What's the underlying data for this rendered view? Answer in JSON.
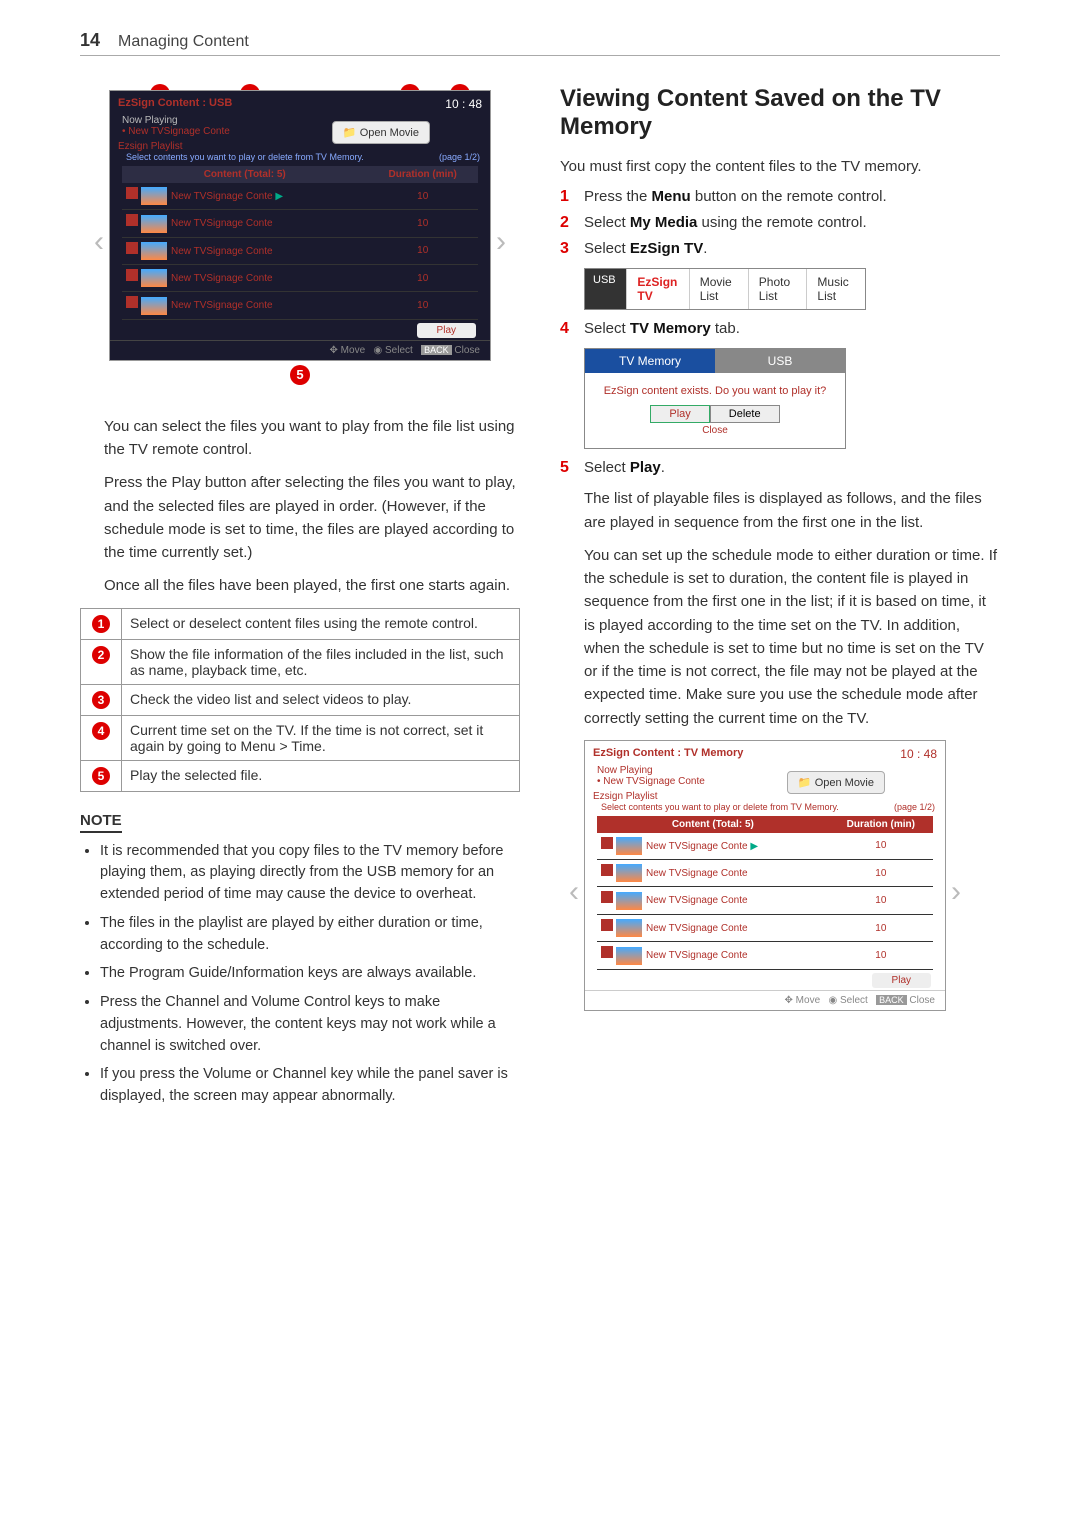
{
  "page_number": "14",
  "section_title": "Managing Content",
  "right": {
    "heading": "Viewing Content Saved on the TV Memory",
    "intro": "You must first copy the content files to the TV memory.",
    "step1": "Press the Menu button on the remote control.",
    "step1_bold": "Menu",
    "step2": "Select My Media using the remote control.",
    "step2_bold": "My Media",
    "step3": "Select EzSign TV.",
    "step3_bold": "EzSign TV",
    "step4": "Select TV Memory tab.",
    "step4_bold": "TV Memory",
    "step5": "Select Play.",
    "step5_bold": "Play",
    "after5_p1": "The list of playable files is displayed as follows, and the files are played in sequence from the first one in the list.",
    "after5_p2": "You can set up the schedule mode to either duration or time. If the schedule is set to duration, the content file is played in sequence from the first one in the list; if it is based on time, it is played according to the time set on the TV. In addition, when the schedule is set to time but no time is set on the TV or if the time is not correct, the file may not be played at the expected time. Make sure you use the schedule mode after correctly setting the current time on the TV."
  },
  "tabs": {
    "usb_label": "USB",
    "ezsigntv": "EzSign TV",
    "movielist": "Movie List",
    "photolist": "Photo List",
    "musiclist": "Music List"
  },
  "memory_dialog": {
    "tvmem": "TV Memory",
    "usb": "USB",
    "question": "EzSign content exists. Do you want to play it?",
    "play": "Play",
    "delete": "Delete",
    "close": "Close"
  },
  "ui_usb": {
    "title": "EzSign Content : USB",
    "time": "10 : 48",
    "now_playing": "Now Playing",
    "now_item": "• New TVSignage Conte",
    "open": "Open Movie",
    "playlist_label": "Ezsign Playlist",
    "hint": "Select contents you want to play or delete from TV Memory.",
    "pager": "(page 1/2)",
    "col1": "Content (Total: 5)",
    "col2": "Duration (min)",
    "rows": [
      {
        "name": "New TVSignage Conte",
        "dur": "10",
        "playing": true
      },
      {
        "name": "New TVSignage Conte",
        "dur": "10"
      },
      {
        "name": "New TVSignage Conte",
        "dur": "10"
      },
      {
        "name": "New TVSignage Conte",
        "dur": "10"
      },
      {
        "name": "New TVSignage Conte",
        "dur": "10"
      }
    ],
    "playbtn": "Play",
    "footer_move": "Move",
    "footer_select": "Select",
    "footer_close": "Close",
    "footer_back": "BACK"
  },
  "ui_tvmem": {
    "title": "EzSign Content : TV Memory"
  },
  "left": {
    "p1": "You can select the files you want to play from the file list using the TV remote control.",
    "p2": "Press the Play button after selecting the files you want to play, and the selected files are played in order. (However, if the schedule mode is set to time, the files are played according to the time currently set.)",
    "p3": "Once all the files have been played, the first one starts again.",
    "legend": {
      "1": "Select or deselect content files using the remote control.",
      "2": "Show the file information of the files included in the list, such as name, playback time, etc.",
      "3": "Check the video list and select videos to play.",
      "4": "Current time set on the TV. If the time is not correct, set it again by going to Menu > Time.",
      "4_bold": "Menu > Time",
      "5": "Play the selected file."
    },
    "note_title": "NOTE",
    "notes": [
      "It is recommended that you copy files to the TV memory before playing them, as playing directly from the USB memory for an extended period of time may cause the device to overheat.",
      "The files in the playlist are played by either duration or time, according to the schedule.",
      "The Program Guide/Information keys are always available.",
      "Press the Channel and Volume Control keys to make adjustments. However, the content keys may not work while a channel is switched over.",
      "If you press the Volume or Channel key while the panel saver is displayed, the screen may appear abnormally."
    ]
  }
}
